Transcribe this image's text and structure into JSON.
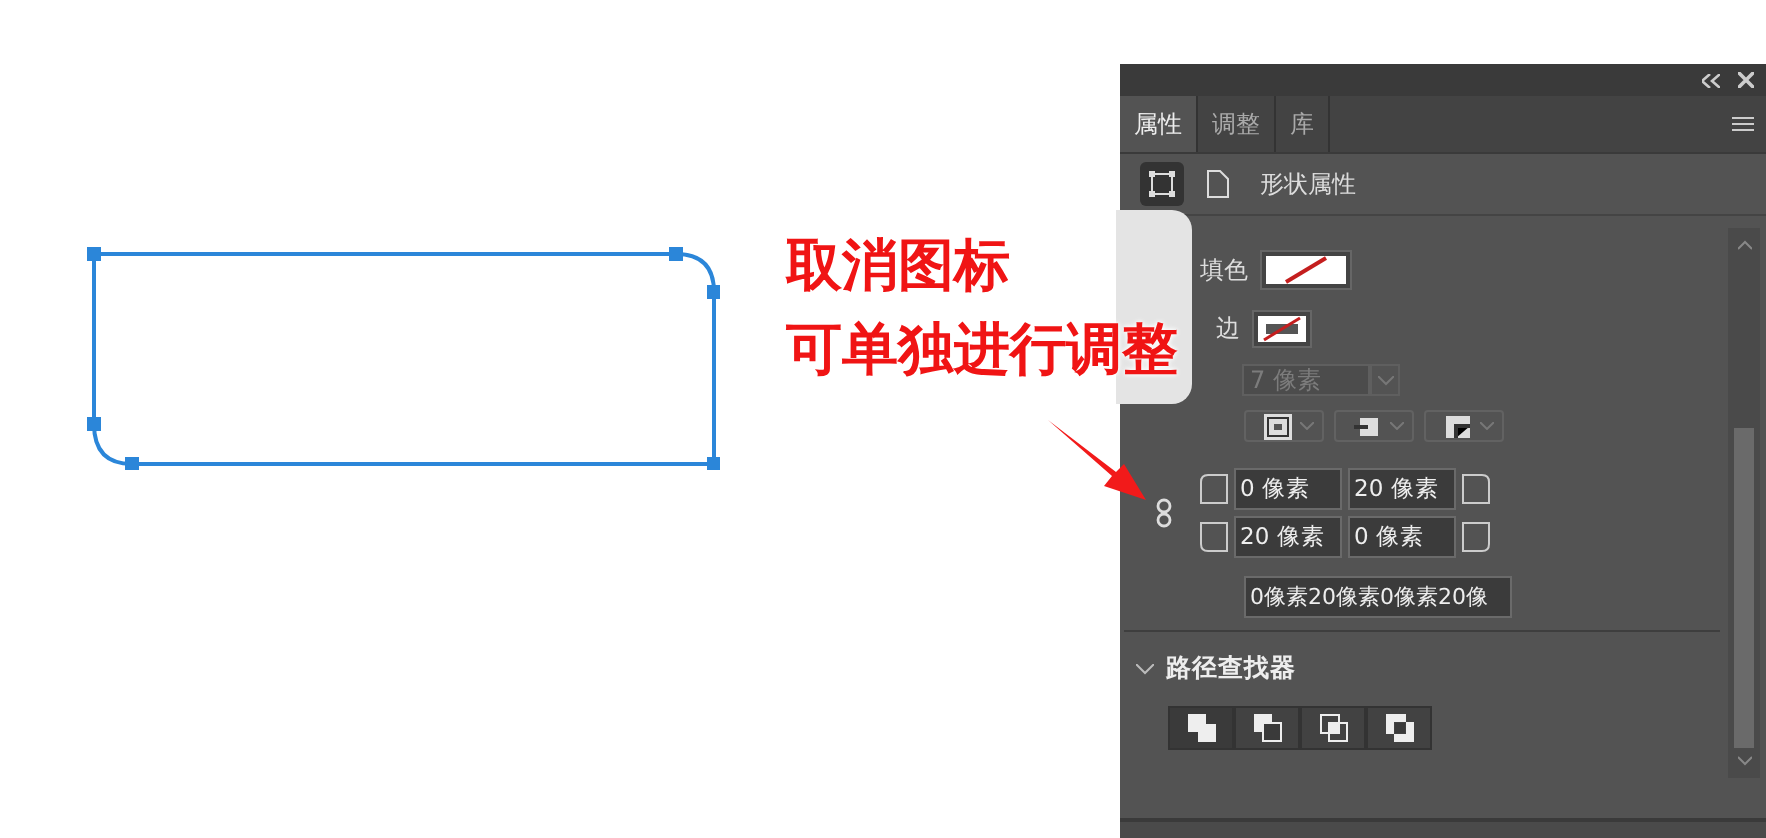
{
  "tabs": [
    {
      "label": "属性",
      "selected": true
    },
    {
      "label": "调整",
      "selected": false
    },
    {
      "label": "库",
      "selected": false
    }
  ],
  "mode_buttons": [
    {
      "kind": "shape",
      "selected": true
    },
    {
      "kind": "document",
      "selected": false
    }
  ],
  "section_title": "形状属性",
  "fill": {
    "label": "填色"
  },
  "stroke": {
    "label": "边"
  },
  "stroke_width": {
    "value": "7 像素"
  },
  "corner_radii": [
    "0 像素",
    "20 像素",
    "20 像素",
    "0 像素"
  ],
  "corner_summary": "0像素20像素0像素20像",
  "pathfinder": {
    "title": "路径查找器",
    "expanded": true
  },
  "annotation": {
    "lines": [
      "取消图标",
      "可单独进行调整"
    ]
  }
}
